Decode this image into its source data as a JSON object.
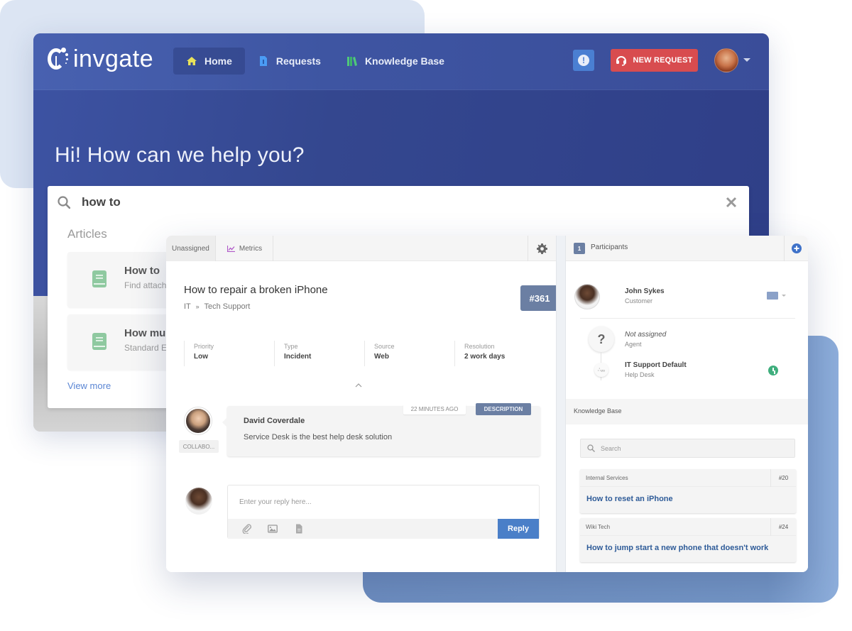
{
  "portal": {
    "brand": "invgate",
    "nav": [
      {
        "label": "Home",
        "icon": "home-icon",
        "active": true,
        "icon_color": "#e8e25a"
      },
      {
        "label": "Requests",
        "icon": "file-icon",
        "active": false,
        "icon_color": "#4b9cf5"
      },
      {
        "label": "Knowledge Base",
        "icon": "books-icon",
        "active": false,
        "icon_color": "#4fc97a"
      }
    ],
    "alert_icon": "exclamation-icon",
    "new_request_label": "NEW REQUEST",
    "hero_title": "Hi! How can we help you?",
    "search": {
      "value": "how to",
      "articles_label": "Articles",
      "articles": [
        {
          "title": "How to",
          "subtitle": "Find attach"
        },
        {
          "title": "How muc",
          "subtitle": "Standard En"
        }
      ],
      "view_more": "View more"
    }
  },
  "ticket": {
    "tabs": [
      {
        "label": "Unassigned"
      },
      {
        "label": "Metrics",
        "icon": "chart-icon"
      }
    ],
    "title": "How to repair a broken iPhone",
    "breadcrumb": [
      "IT",
      "Tech Support"
    ],
    "breadcrumb_sep": "»",
    "id": "#361",
    "fields": [
      {
        "label": "Priority",
        "value": "Low"
      },
      {
        "label": "Type",
        "value": "Incident"
      },
      {
        "label": "Source",
        "value": "Web"
      },
      {
        "label": "Resolution",
        "value": "2 work days"
      }
    ],
    "comment": {
      "author": "David Coverdale",
      "text": "Service Desk is the best help desk solution",
      "time": "22 MINUTES AGO",
      "tag": "DESCRIPTION",
      "role_tag": "COLLABO..."
    },
    "reply": {
      "placeholder": "Enter your reply here...",
      "button": "Reply"
    }
  },
  "participants": {
    "count": "1",
    "title": "Participants",
    "people": [
      {
        "name": "John Sykes",
        "role": "Customer"
      },
      {
        "name": "Not assigned",
        "role": "Agent"
      },
      {
        "name": "IT Support Default",
        "role": "Help Desk"
      }
    ],
    "helpdesk_badge": "∴₂₀"
  },
  "knowledge_base": {
    "title": "Knowledge Base",
    "search_placeholder": "Search",
    "articles": [
      {
        "category": "Internal Services",
        "number": "#20",
        "title": "How to reset an  iPhone"
      },
      {
        "category": "Wiki Tech",
        "number": "#24",
        "title": "How to jump start a new phone that doesn't work"
      }
    ]
  },
  "colors": {
    "navbar": "#4861b0",
    "hero": "#34478f",
    "new_request": "#d84c4f",
    "accent_blue": "#4a7fc8",
    "tag_slate": "#6b7fa3",
    "link_blue": "#2e5b98",
    "status_green": "#3fae7d"
  }
}
